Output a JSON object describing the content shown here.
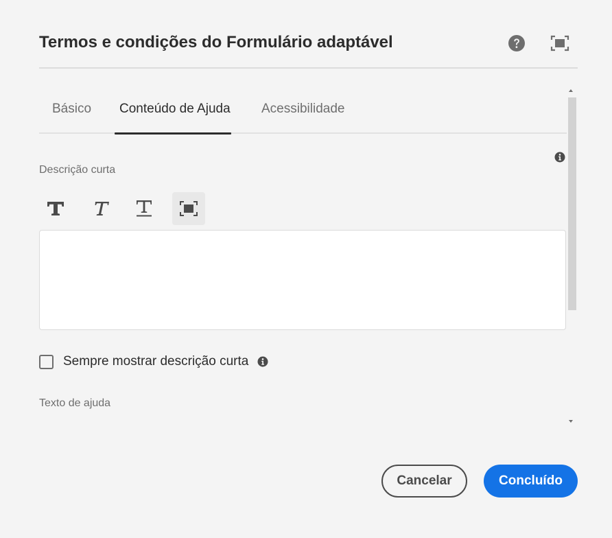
{
  "dialog": {
    "title": "Termos e condições do Formulário adaptável"
  },
  "header_icons": [
    "help-icon",
    "fullscreen-icon"
  ],
  "tabs": [
    {
      "label": "Básico",
      "active": false
    },
    {
      "label": "Conteúdo de Ajuda",
      "active": true
    },
    {
      "label": "Acessibilidade",
      "active": false
    }
  ],
  "short_description": {
    "label": "Descrição curta",
    "value": ""
  },
  "toolbar_icons": [
    "bold-icon",
    "italic-icon",
    "underline-icon",
    "expand-icon"
  ],
  "always_show": {
    "label": "Sempre mostrar descrição curta",
    "checked": false
  },
  "help_text": {
    "label": "Texto de ajuda"
  },
  "footer": {
    "cancel_label": "Cancelar",
    "done_label": "Concluído"
  },
  "colors": {
    "primary": "#1473e6",
    "background": "#f4f4f4",
    "text": "#2c2c2c",
    "muted": "#6e6e6e"
  }
}
